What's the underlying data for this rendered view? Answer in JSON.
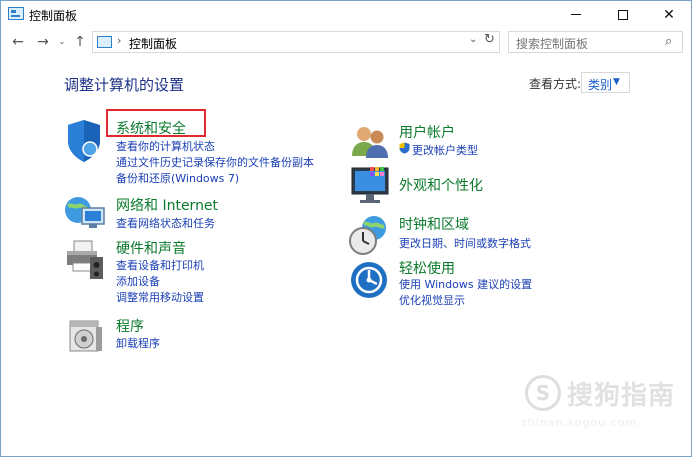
{
  "window": {
    "title": "控制面板",
    "controls": {
      "minimize": "",
      "maximize": "",
      "close": "✕"
    }
  },
  "nav": {
    "back": "←",
    "forward": "→",
    "recent": "⌄",
    "up": "↑",
    "address_separator": "›",
    "address_text": "控制面板",
    "address_dropdown": "⌄",
    "refresh": "↻",
    "search_placeholder": "搜索控制面板",
    "search_icon": "⌕"
  },
  "content": {
    "title": "调整计算机的设置",
    "view_by_label": "查看方式:",
    "view_by_value": "类别",
    "view_by_caret": "▼"
  },
  "categories_left": [
    {
      "title": "系统和安全",
      "icon": "shield-icon",
      "links": [
        "查看你的计算机状态",
        "通过文件历史记录保存你的文件备份副本",
        "备份和还原(Windows 7)"
      ]
    },
    {
      "title": "网络和 Internet",
      "icon": "network-globe-icon",
      "links": [
        "查看网络状态和任务"
      ]
    },
    {
      "title": "硬件和声音",
      "icon": "printer-speaker-icon",
      "links": [
        "查看设备和打印机",
        "添加设备",
        "调整常用移动设置"
      ]
    },
    {
      "title": "程序",
      "icon": "programs-disc-icon",
      "links": [
        "卸载程序"
      ]
    }
  ],
  "categories_right": [
    {
      "title": "用户帐户",
      "icon": "users-icon",
      "links": [
        "更改帐户类型"
      ]
    },
    {
      "title": "外观和个性化",
      "icon": "monitor-palette-icon",
      "links": []
    },
    {
      "title": "时钟和区域",
      "icon": "clock-globe-icon",
      "links": [
        "更改日期、时间或数字格式"
      ]
    },
    {
      "title": "轻松使用",
      "icon": "ease-of-access-icon",
      "links": [
        "使用 Windows 建议的设置",
        "优化视觉显示"
      ]
    }
  ],
  "watermark": {
    "glyph": "S",
    "text": "搜狗指南",
    "url": "zhinan.sogou.com"
  },
  "colors": {
    "category_title": "#0b7a2c",
    "link": "#1a3fb5",
    "heading": "#1e3287",
    "highlight_box": "#e0282e"
  }
}
